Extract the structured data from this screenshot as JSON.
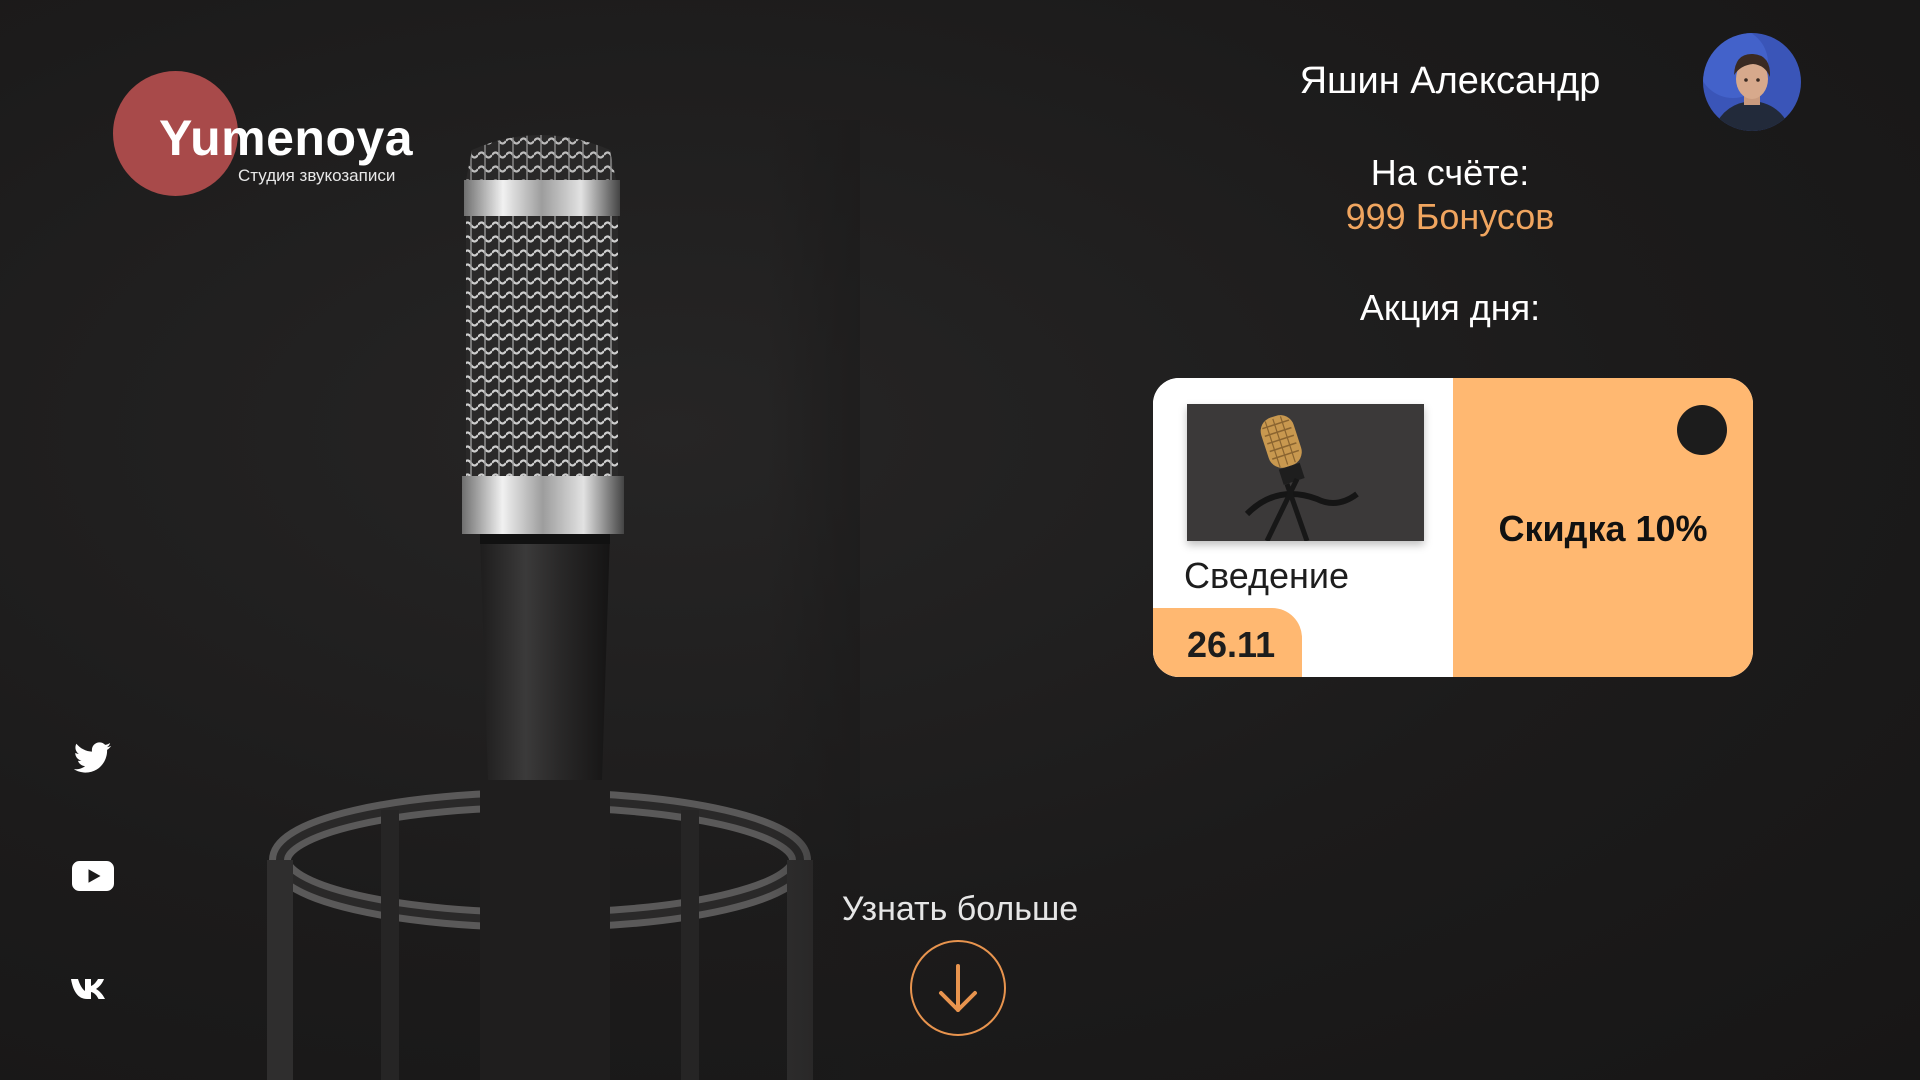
{
  "brand": {
    "name": "Yumenoya",
    "tagline": "Студия звукозаписи",
    "circle_color": "#a84a4a"
  },
  "user": {
    "name": "Яшин Александр",
    "avatar_icon": "user-avatar"
  },
  "balance": {
    "label": "На счёте:",
    "value": "999 Бонусов"
  },
  "promo": {
    "heading": "Акция дня:",
    "service": "Сведение",
    "date": "26.11",
    "discount": "Скидка 10%",
    "accent_color": "#ffb871"
  },
  "cta": {
    "label": "Узнать больше",
    "icon": "arrow-down-icon",
    "accent_color": "#e8944e"
  },
  "social": [
    {
      "icon": "twitter-icon"
    },
    {
      "icon": "youtube-icon"
    },
    {
      "icon": "vk-icon"
    }
  ],
  "colors": {
    "background": "#1b1a1a",
    "accent_text": "#f0a55f"
  }
}
